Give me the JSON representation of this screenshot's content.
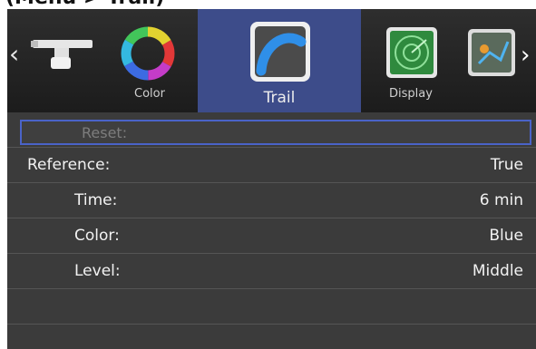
{
  "caption": "(Menu > Trail)",
  "toolbar": {
    "prev_glyph": "‹",
    "next_glyph": "›",
    "items": [
      {
        "label": "",
        "icon": "aircraft-icon"
      },
      {
        "label": "Color",
        "icon": "color-wheel-icon"
      },
      {
        "label": "Trail",
        "icon": "trail-icon",
        "selected": true
      },
      {
        "label": "Display",
        "icon": "display-radar-icon"
      },
      {
        "label": "",
        "icon": "map-target-icon"
      }
    ]
  },
  "list": {
    "reset_label": "Reset:",
    "rows": [
      {
        "key": "Reference:",
        "value": "True"
      },
      {
        "key": "Time:",
        "value": "6 min"
      },
      {
        "key": "Color:",
        "value": "Blue"
      },
      {
        "key": "Level:",
        "value": "Middle"
      }
    ]
  },
  "colors": {
    "selected_tab": "#3d4c8a",
    "focus_border": "#4a63c8",
    "trail_blue": "#2f8fe8"
  }
}
